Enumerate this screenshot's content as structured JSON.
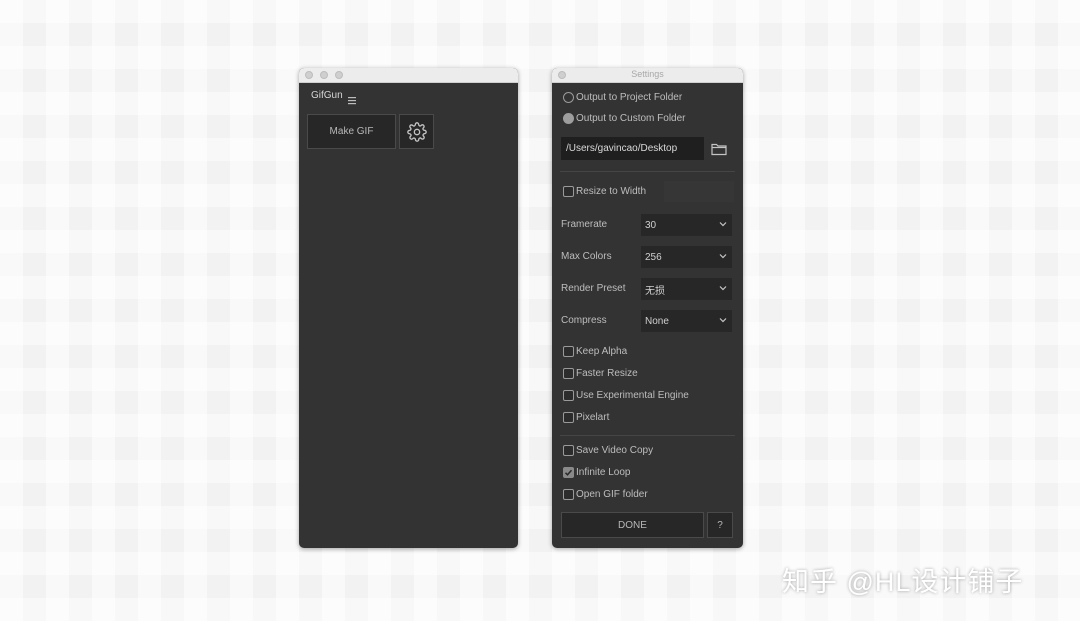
{
  "gifgun_window": {
    "app_name": "GifGun",
    "menu_icon": "hamburger-menu-icon",
    "make_gif_label": "Make GIF",
    "settings_icon": "gear-icon"
  },
  "settings_window": {
    "title": "Settings",
    "output_options": [
      {
        "label": "Output to Project Folder",
        "selected": false
      },
      {
        "label": "Output to Custom Folder",
        "selected": true
      }
    ],
    "output_path": "/Users/gavincao/Desktop",
    "folder_icon": "folder-icon",
    "resize_to_width": {
      "label": "Resize to Width",
      "checked": false
    },
    "framerate": {
      "label": "Framerate",
      "value": "30"
    },
    "max_colors": {
      "label": "Max Colors",
      "value": "256"
    },
    "render_preset": {
      "label": "Render Preset",
      "value": "无损"
    },
    "compress": {
      "label": "Compress",
      "value": "None"
    },
    "options_group1": [
      {
        "label": "Keep Alpha",
        "checked": false
      },
      {
        "label": "Faster Resize",
        "checked": false
      },
      {
        "label": "Use Experimental Engine",
        "checked": false
      },
      {
        "label": "Pixelart",
        "checked": false
      }
    ],
    "options_group2": [
      {
        "label": "Save Video Copy",
        "checked": false
      },
      {
        "label": "Infinite Loop",
        "checked": true
      },
      {
        "label": "Open GIF folder",
        "checked": false
      }
    ],
    "done_label": "DONE",
    "help_label": "?"
  },
  "watermark": "知乎 @HL设计铺子",
  "colors": {
    "panel_bg": "#333333",
    "field_bg": "#1f1f1f",
    "text": "#bdbdbd"
  }
}
